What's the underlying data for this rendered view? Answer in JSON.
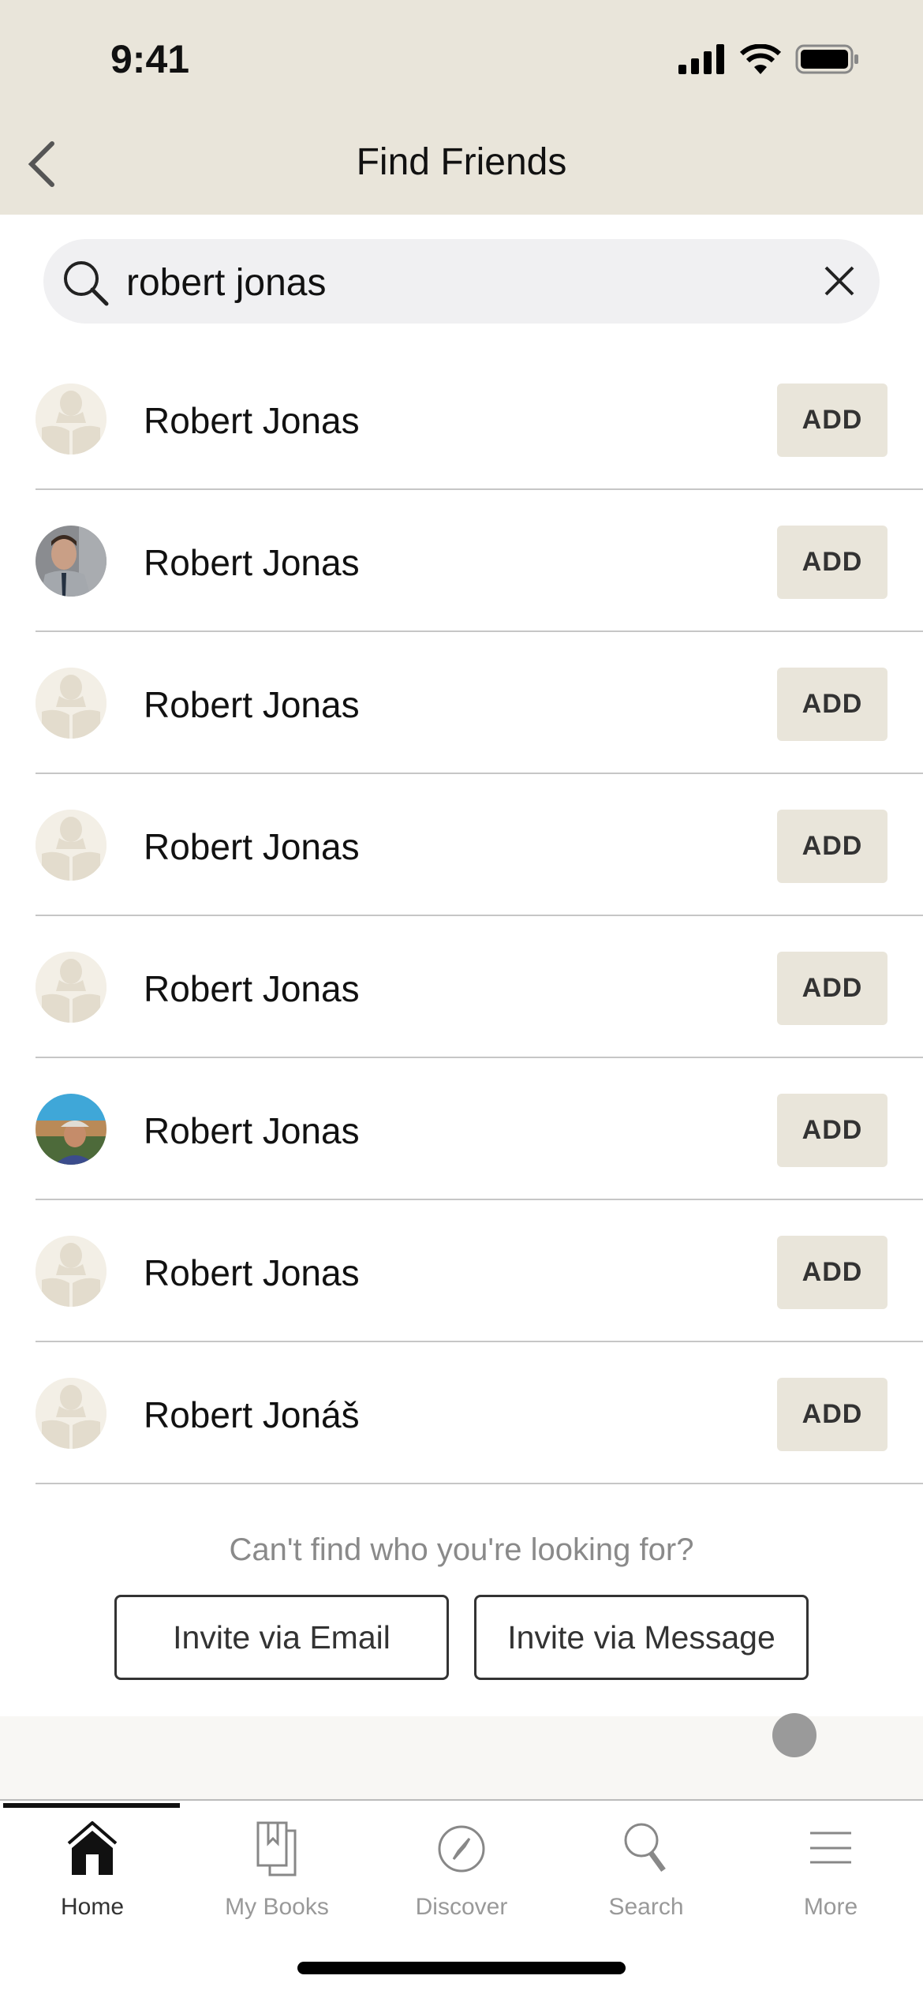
{
  "status": {
    "time": "9:41"
  },
  "header": {
    "title": "Find Friends"
  },
  "search": {
    "value": "robert jonas"
  },
  "results": [
    {
      "name": "Robert Jonas",
      "avatar": "placeholder",
      "action": "ADD"
    },
    {
      "name": "Robert Jonas",
      "avatar": "photo",
      "action": "ADD"
    },
    {
      "name": "Robert Jonas",
      "avatar": "placeholder",
      "action": "ADD"
    },
    {
      "name": "Robert Jonas",
      "avatar": "placeholder",
      "action": "ADD"
    },
    {
      "name": "Robert Jonas",
      "avatar": "placeholder",
      "action": "ADD"
    },
    {
      "name": "Robert Jonas",
      "avatar": "photo",
      "action": "ADD"
    },
    {
      "name": "Robert Jonas",
      "avatar": "placeholder",
      "action": "ADD"
    },
    {
      "name": "Robert Jonáš",
      "avatar": "placeholder",
      "action": "ADD"
    }
  ],
  "footer": {
    "prompt": "Can't find who you're looking for?",
    "invite_email": "Invite via Email",
    "invite_message": "Invite via Message"
  },
  "nav": {
    "items": [
      {
        "label": "Home",
        "icon": "home-icon",
        "active": true
      },
      {
        "label": "My Books",
        "icon": "books-icon"
      },
      {
        "label": "Discover",
        "icon": "compass-icon"
      },
      {
        "label": "Search",
        "icon": "search-icon"
      },
      {
        "label": "More",
        "icon": "menu-icon"
      }
    ]
  },
  "colors": {
    "header_bg": "#e9e5da",
    "button_bg": "#e9e5da"
  }
}
